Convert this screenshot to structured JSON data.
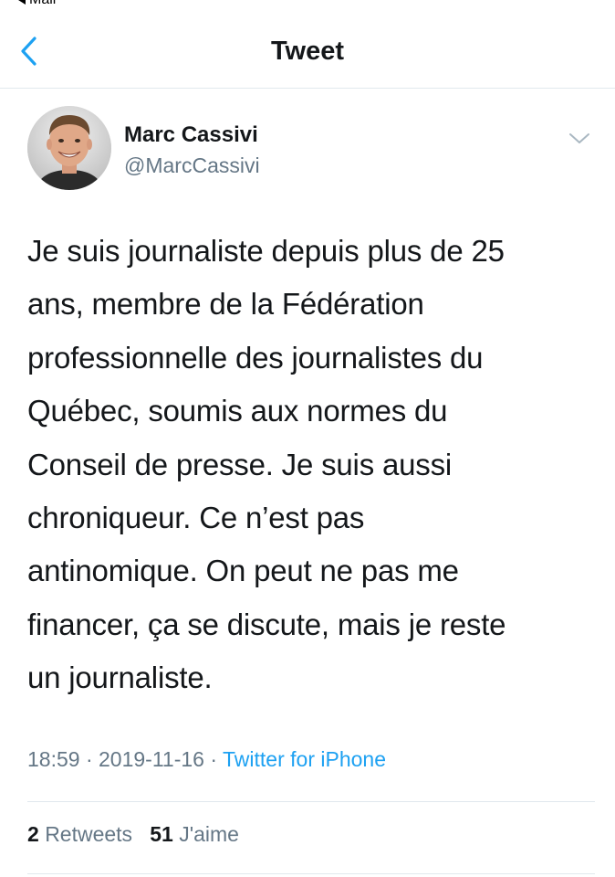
{
  "status_bar": {
    "back_label": "Mail"
  },
  "nav": {
    "title": "Tweet",
    "accent_color": "#1da1f2"
  },
  "author": {
    "display_name": "Marc Cassivi",
    "handle": "@MarcCassivi"
  },
  "tweet": {
    "lines": [
      "Je suis journaliste depuis plus de 25",
      "ans, membre de la Fédération",
      "professionnelle des journalistes du",
      "Québec, soumis aux normes du",
      "Conseil de presse. Je suis aussi",
      "chroniqueur. Ce n’est pas",
      "antinomique. On peut ne pas me",
      "financer, ça se discute, mais je reste",
      "un journaliste."
    ],
    "time": "18:59",
    "separator": "·",
    "date": "2019-11-16",
    "source": "Twitter for iPhone"
  },
  "stats": {
    "retweets_count": "2",
    "retweets_label": "Retweets",
    "likes_count": "51",
    "likes_label": "J'aime"
  }
}
